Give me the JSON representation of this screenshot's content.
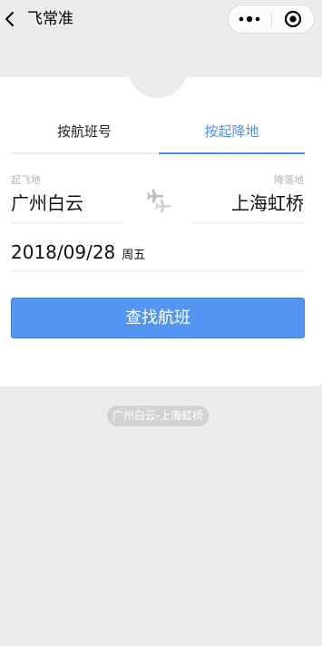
{
  "nav": {
    "title": "飞常准",
    "back_icon": "chevron-left-icon",
    "more_icon": "more-dots-icon",
    "close_icon": "target-close-icon"
  },
  "tabs": [
    {
      "label": "按航班号",
      "active": false
    },
    {
      "label": "按起降地",
      "active": true
    }
  ],
  "route": {
    "departure_label": "起飞地",
    "departure_city": "广州白云",
    "arrival_label": "降落地",
    "arrival_city": "上海虹桥",
    "swap_icon": "airplane-swap-icon"
  },
  "date": {
    "value": "2018/09/28",
    "weekday": "周五"
  },
  "search_button": {
    "label": "查找航班"
  },
  "history": [
    {
      "label": "广州白云-上海虹桥"
    }
  ],
  "colors": {
    "accent": "#4b8fe6",
    "button": "#5295f2",
    "background": "#ececec",
    "card": "#ffffff",
    "muted_text": "#b3b3b3",
    "chip": "#d3d3d3"
  }
}
